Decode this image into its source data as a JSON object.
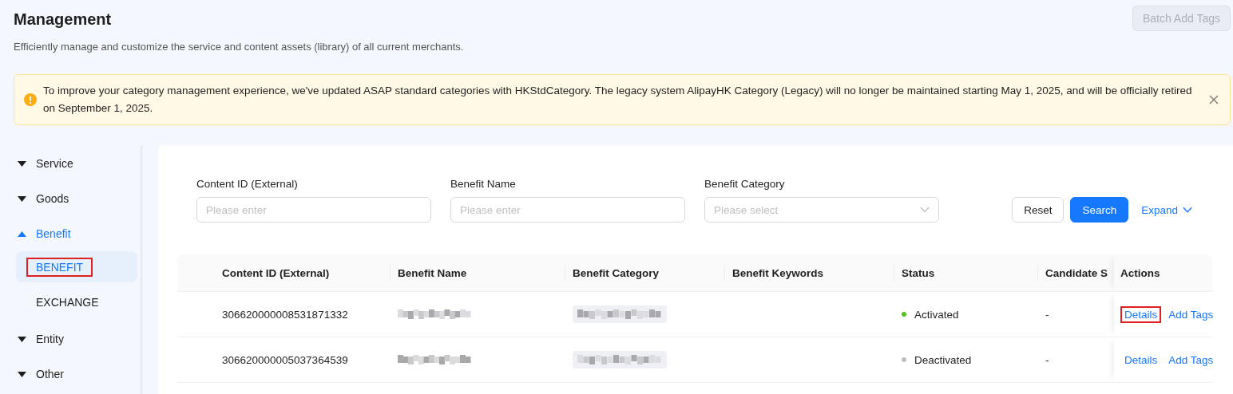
{
  "page": {
    "title": "Management",
    "subtitle": "Efficiently manage and customize the service and content assets (library) of all current merchants.",
    "batch_button": {
      "label": "Batch Add Tags",
      "disabled": true
    }
  },
  "alert": {
    "text": "To improve your category management experience, we've updated ASAP standard categories with HKStdCategory. The legacy system AlipayHK Category (Legacy) will no longer be maintained starting May 1, 2025, and will be officially retired on September 1, 2025.",
    "closable": true
  },
  "sidebar": {
    "items": [
      {
        "label": "Service",
        "expanded": false,
        "selected": false
      },
      {
        "label": "Goods",
        "expanded": false,
        "selected": false
      },
      {
        "label": "Benefit",
        "expanded": true,
        "selected": true,
        "children": [
          {
            "label": "BENEFIT",
            "selected": true,
            "highlighted": true
          },
          {
            "label": "EXCHANGE",
            "selected": false,
            "highlighted": false
          }
        ]
      },
      {
        "label": "Entity",
        "expanded": false,
        "selected": false
      },
      {
        "label": "Other",
        "expanded": false,
        "selected": false
      }
    ]
  },
  "filters": [
    {
      "label": "Content ID (External)",
      "kind": "input",
      "placeholder": "Please enter"
    },
    {
      "label": "Benefit Name",
      "kind": "input",
      "placeholder": "Please enter"
    },
    {
      "label": "Benefit Category",
      "kind": "select",
      "placeholder": "Please select"
    }
  ],
  "filter_actions": {
    "reset": "Reset",
    "search": "Search",
    "expand": "Expand"
  },
  "table": {
    "columns": [
      "Content ID (External)",
      "Benefit Name",
      "Benefit Category",
      "Benefit Keywords",
      "Status",
      "Candidate S",
      "Actions"
    ],
    "rows": [
      {
        "cells": [
          {
            "kind": "text",
            "text": "306620000008531871332"
          },
          {
            "kind": "redacted"
          },
          {
            "kind": "redacted_tag"
          },
          {
            "kind": "empty"
          },
          {
            "kind": "status",
            "text": "Activated",
            "color": "#52c41a"
          },
          {
            "kind": "text",
            "text": "-"
          },
          {
            "kind": "actions",
            "links": [
              {
                "label": "Details",
                "highlighted": true
              },
              {
                "label": "Add Tags",
                "highlighted": false
              }
            ]
          }
        ]
      },
      {
        "cells": [
          {
            "kind": "text",
            "text": "306620000005037364539"
          },
          {
            "kind": "redacted"
          },
          {
            "kind": "redacted_tag"
          },
          {
            "kind": "empty"
          },
          {
            "kind": "status",
            "text": "Deactivated",
            "color": "#bfbfbf"
          },
          {
            "kind": "text",
            "text": "-"
          },
          {
            "kind": "actions",
            "links": [
              {
                "label": "Details",
                "highlighted": false
              },
              {
                "label": "Add Tags",
                "highlighted": false
              }
            ]
          }
        ]
      }
    ]
  }
}
